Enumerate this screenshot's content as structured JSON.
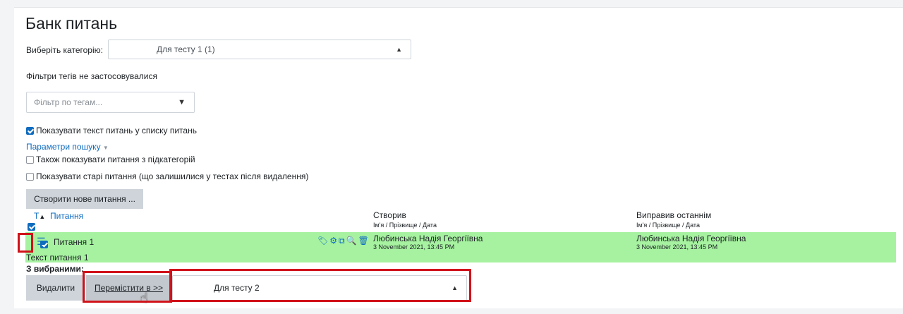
{
  "page_title": "Банк питань",
  "category": {
    "label": "Виберіть категорію:",
    "selected": "Для тесту 1 (1)"
  },
  "tag_filters_text": "Фільтри тегів не застосовувалися",
  "tag_filter_placeholder": "Фільтр по тегам...",
  "show_question_text_label": "Показувати текст питань у списку питань",
  "search_params_link": "Параметри пошуку",
  "subcategories_label": "Також показувати питання з підкатегорій",
  "old_questions_label": "Показувати старі питання (що залишилися у тестах після видалення)",
  "create_button": "Створити нове питання ...",
  "table": {
    "col_type": "T",
    "col_question": "Питання",
    "col_created_by": "Створив",
    "col_modified_by": "Виправив останнім",
    "sort_first": "Ім'я",
    "sort_sep1": " / ",
    "sort_last": "Прізвище",
    "sort_sep2": " / ",
    "sort_date": "Дата",
    "sort_first_2": "Ім'я",
    "sort_last_2": "Прізвище",
    "sort_date_2": "Дата",
    "rows": [
      {
        "name": "Питання 1",
        "text": "Текст питання 1",
        "created_by": "Любинська Надія Георгіївна",
        "created_date": "3 November 2021, 13:45 PM",
        "modified_by": "Любинська Надія Георгіївна",
        "modified_date": "3 November 2021, 13:45 PM"
      }
    ]
  },
  "with_selected_label": "З вибраними:",
  "delete_button": "Видалити",
  "move_button": "Перемістити в >>",
  "move_target": "Для тесту 2",
  "colors": {
    "highlight_row": "#a6f2a0",
    "link": "#0f6cbf",
    "annotation": "#d0121a"
  }
}
